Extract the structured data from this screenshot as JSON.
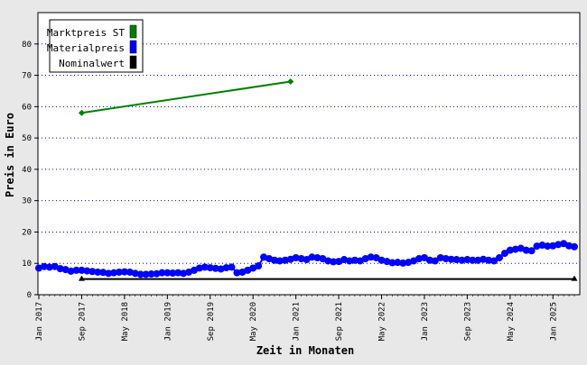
{
  "chart_data": {
    "type": "line",
    "title": "",
    "xlabel": "Zeit in Monaten",
    "ylabel": "Preis in Euro",
    "ylim": [
      0,
      90
    ],
    "yticks": [
      0,
      10,
      20,
      30,
      40,
      50,
      60,
      70,
      80
    ],
    "grid": "horizontal-dotted",
    "legend_position": "top-left",
    "x_start": "2017-01",
    "x_end": "2025-05",
    "xtick_labels": [
      {
        "label": "Jan 2017",
        "date": "2017-01"
      },
      {
        "label": "Sep 2017",
        "date": "2017-09"
      },
      {
        "label": "May 2018",
        "date": "2018-05"
      },
      {
        "label": "Jan 2019",
        "date": "2019-01"
      },
      {
        "label": "Sep 2019",
        "date": "2019-09"
      },
      {
        "label": "May 2020",
        "date": "2020-05"
      },
      {
        "label": "Jan 2021",
        "date": "2021-01"
      },
      {
        "label": "Sep 2021",
        "date": "2021-09"
      },
      {
        "label": "May 2022",
        "date": "2022-05"
      },
      {
        "label": "Jan 2023",
        "date": "2023-01"
      },
      {
        "label": "Sep 2023",
        "date": "2023-09"
      },
      {
        "label": "May 2024",
        "date": "2024-05"
      },
      {
        "label": "Jan 2025",
        "date": "2025-01"
      }
    ],
    "series": [
      {
        "name": "Marktpreis ST",
        "color": "#008000",
        "marker": "diamond",
        "x": [
          "2017-09",
          "2020-12"
        ],
        "y": [
          58,
          68
        ]
      },
      {
        "name": "Materialpreis",
        "color": "#0000ff",
        "marker": "circle",
        "x": [
          "2017-01",
          "2017-02",
          "2017-03",
          "2017-04",
          "2017-05",
          "2017-06",
          "2017-07",
          "2017-08",
          "2017-09",
          "2017-10",
          "2017-11",
          "2017-12",
          "2018-01",
          "2018-02",
          "2018-03",
          "2018-04",
          "2018-05",
          "2018-06",
          "2018-07",
          "2018-08",
          "2018-09",
          "2018-10",
          "2018-11",
          "2018-12",
          "2019-01",
          "2019-02",
          "2019-03",
          "2019-04",
          "2019-05",
          "2019-06",
          "2019-07",
          "2019-08",
          "2019-09",
          "2019-10",
          "2019-11",
          "2019-12",
          "2020-01",
          "2020-02",
          "2020-03",
          "2020-04",
          "2020-05",
          "2020-06",
          "2020-07",
          "2020-08",
          "2020-09",
          "2020-10",
          "2020-11",
          "2020-12",
          "2021-01",
          "2021-02",
          "2021-03",
          "2021-04",
          "2021-05",
          "2021-06",
          "2021-07",
          "2021-08",
          "2021-09",
          "2021-10",
          "2021-11",
          "2021-12",
          "2022-01",
          "2022-02",
          "2022-03",
          "2022-04",
          "2022-05",
          "2022-06",
          "2022-07",
          "2022-08",
          "2022-09",
          "2022-10",
          "2022-11",
          "2022-12",
          "2023-01",
          "2023-02",
          "2023-03",
          "2023-04",
          "2023-05",
          "2023-06",
          "2023-07",
          "2023-08",
          "2023-09",
          "2023-10",
          "2023-11",
          "2023-12",
          "2024-01",
          "2024-02",
          "2024-03",
          "2024-04",
          "2024-05",
          "2024-06",
          "2024-07",
          "2024-08",
          "2024-09",
          "2024-10",
          "2024-11",
          "2024-12",
          "2025-01",
          "2025-02",
          "2025-03",
          "2025-04",
          "2025-05"
        ],
        "y": [
          8.5,
          9.0,
          8.8,
          9.0,
          8.3,
          8.0,
          7.5,
          7.8,
          7.8,
          7.6,
          7.4,
          7.2,
          7.1,
          6.8,
          7.0,
          7.2,
          7.3,
          7.2,
          6.8,
          6.5,
          6.5,
          6.6,
          6.7,
          7.0,
          7.0,
          6.9,
          7.0,
          6.8,
          7.2,
          7.8,
          8.5,
          8.8,
          8.6,
          8.4,
          8.2,
          8.6,
          8.8,
          7.0,
          7.2,
          7.8,
          8.5,
          9.2,
          12.0,
          11.5,
          11.0,
          10.8,
          11.0,
          11.3,
          11.8,
          11.5,
          11.2,
          12.0,
          11.8,
          11.5,
          10.8,
          10.5,
          10.6,
          11.2,
          10.8,
          11.0,
          10.8,
          11.5,
          12.0,
          11.8,
          11.0,
          10.6,
          10.2,
          10.3,
          10.1,
          10.3,
          10.8,
          11.5,
          11.8,
          11.0,
          10.8,
          11.8,
          11.5,
          11.3,
          11.2,
          11.0,
          11.2,
          11.0,
          11.0,
          11.3,
          11.0,
          10.8,
          11.8,
          13.2,
          14.2,
          14.5,
          14.8,
          14.2,
          14.0,
          15.5,
          15.8,
          15.5,
          15.6,
          16.0,
          16.3,
          15.6,
          15.3
        ]
      },
      {
        "name": "Nominalwert",
        "color": "#000000",
        "marker": "triangle",
        "x": [
          "2017-09",
          "2025-05"
        ],
        "y": [
          5,
          5
        ]
      }
    ]
  }
}
